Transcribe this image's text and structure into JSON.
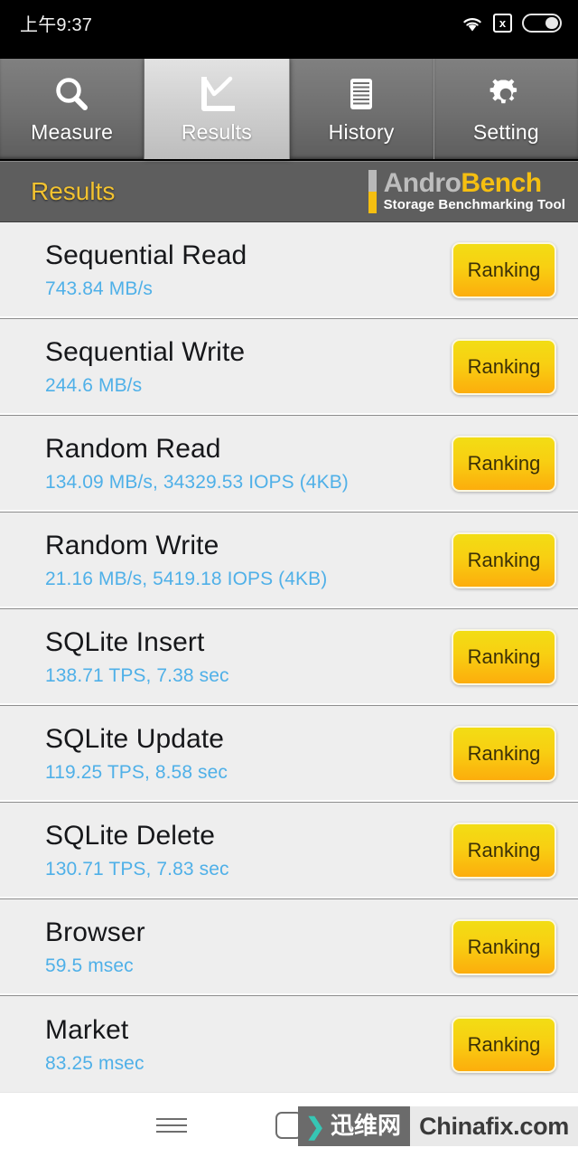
{
  "status_bar": {
    "time": "上午9:37",
    "icons": [
      {
        "name": "wifi-icon"
      },
      {
        "name": "no-sim-icon",
        "glyph": "x"
      },
      {
        "name": "battery-icon"
      }
    ]
  },
  "tabs": [
    {
      "label": "Measure",
      "icon": "search-icon",
      "selected": false
    },
    {
      "label": "Results",
      "icon": "chart-icon",
      "selected": true
    },
    {
      "label": "History",
      "icon": "document-icon",
      "selected": false
    },
    {
      "label": "Setting",
      "icon": "gear-icon",
      "selected": false
    }
  ],
  "header": {
    "title": "Results",
    "brand_name_part1": "Andro",
    "brand_name_part2": "Bench",
    "brand_subtitle": "Storage Benchmarking Tool"
  },
  "results": {
    "ranking_label": "Ranking",
    "rows": [
      {
        "title": "Sequential Read",
        "value": "743.84 MB/s"
      },
      {
        "title": "Sequential Write",
        "value": "244.6 MB/s"
      },
      {
        "title": "Random Read",
        "value": "134.09 MB/s, 34329.53 IOPS (4KB)"
      },
      {
        "title": "Random Write",
        "value": "21.16 MB/s, 5419.18 IOPS (4KB)"
      },
      {
        "title": "SQLite Insert",
        "value": "138.71 TPS, 7.38 sec"
      },
      {
        "title": "SQLite Update",
        "value": "119.25 TPS, 8.58 sec"
      },
      {
        "title": "SQLite Delete",
        "value": "130.71 TPS, 7.83 sec"
      },
      {
        "title": "Browser",
        "value": "59.5 msec"
      },
      {
        "title": "Market",
        "value": "83.25 msec"
      }
    ]
  },
  "navigation_bar": {
    "menu": "menu-icon",
    "home": "home-icon",
    "back": "back-icon"
  },
  "watermark": {
    "chevron": "❯",
    "chinese_text": "迅维网",
    "site_text": "Chinafix.com"
  },
  "colors": {
    "accent_yellow": "#f2c230",
    "value_blue": "#4fb0e8",
    "header_gray": "#5e5e5e",
    "row_bg": "#eeeeee"
  }
}
